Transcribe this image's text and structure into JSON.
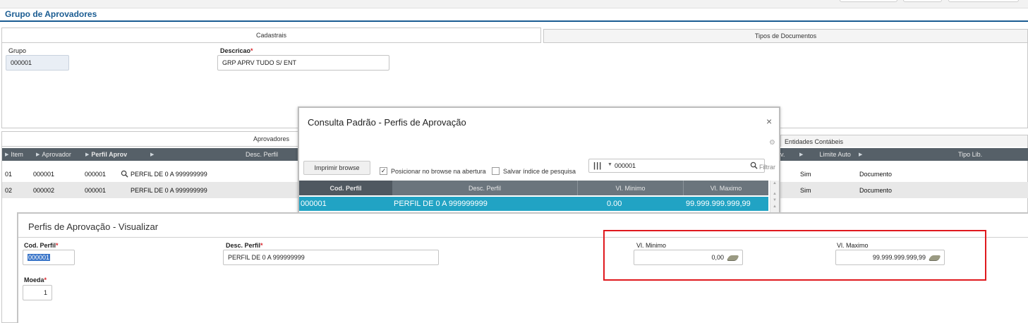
{
  "page": {
    "title": "Grupo de Aprovadores"
  },
  "top_tabs": {
    "cadastrais": "Cadastrais",
    "tipos_documentos": "Tipos de Documentos"
  },
  "form": {
    "grupo_label": "Grupo",
    "grupo_value": "000001",
    "descricao_label": "Descricao",
    "descricao_required": "*",
    "descricao_value": "GRP APRV TUDO S/ ENT"
  },
  "bottom_tabs": {
    "aprovadores": "Aprovadores",
    "entidades": "Entidades Contábeis"
  },
  "grid": {
    "headers": {
      "item": "Item",
      "aprovador": "Aprovador",
      "perfil_aprov": "Perfil Aprov",
      "desc_perfil": "Desc. Perfil",
      "v": "v.",
      "limite_auto": "Limite Auto",
      "tipo_lib": "Tipo Lib."
    },
    "rows": [
      {
        "item": "01",
        "aprovador": "000001",
        "perfil": "000001",
        "desc": "PERFIL DE 0 A 999999999",
        "limite": "Sim",
        "tipo": "Documento"
      },
      {
        "item": "02",
        "aprovador": "000002",
        "perfil": "000001",
        "desc": "PERFIL DE 0 A 999999999",
        "limite": "Sim",
        "tipo": "Documento"
      }
    ]
  },
  "modal": {
    "title": "Consulta Padrão - Perfis de Aprovação",
    "close": "×",
    "print_button": "Imprimir browse",
    "check_posicionar": "Posicionar no browse na abertura",
    "check_salvar": "Salvar índice de pesquisa",
    "search_value": "000001",
    "filter_label": "Filtrar",
    "headers": {
      "cod_perfil": "Cod. Perfil",
      "desc_perfil": "Desc. Perfil",
      "vl_minimo": "Vl. Minimo",
      "vl_maximo": "Vl. Maximo"
    },
    "row": {
      "cod_perfil": "000001",
      "desc_perfil": "PERFIL DE 0 A 999999999",
      "vl_minimo": "0.00",
      "vl_maximo": "99.999.999.999,99"
    }
  },
  "visualizar": {
    "title": "Perfis de Aprovação - Visualizar",
    "cod_perfil_label": "Cod. Perfil",
    "cod_perfil_value": "000001",
    "desc_perfil_label": "Desc. Perfil",
    "desc_perfil_value": "PERFIL DE 0 A 999999999",
    "vl_minimo_label": "Vl. Minimo",
    "vl_minimo_value": "0,00",
    "vl_maximo_label": "Vl. Maximo",
    "vl_maximo_value": "99.999.999.999,99",
    "moeda_label": "Moeda",
    "moeda_value": "1",
    "required_mark": "*"
  },
  "colors": {
    "title_blue": "#1a5c92",
    "grid_header": "#566068",
    "selected_row": "#21a3c4",
    "highlight_red": "#e0191e"
  }
}
